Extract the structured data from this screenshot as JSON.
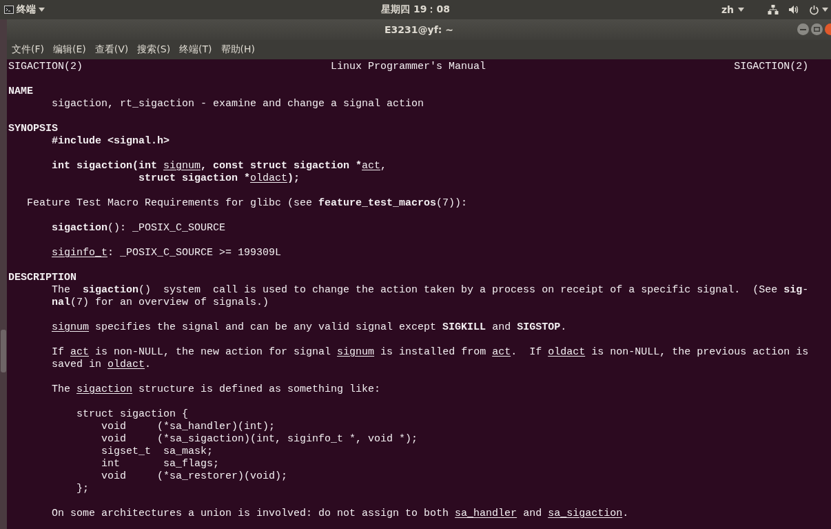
{
  "top_bar": {
    "app_menu": "终端",
    "clock": "星期四 19：08",
    "language": "zh"
  },
  "window": {
    "title": "E3231@yf: ~"
  },
  "menu_bar": [
    "文件(F)",
    "编辑(E)",
    "查看(V)",
    "搜索(S)",
    "终端(T)",
    "帮助(H)"
  ],
  "man_page": {
    "header": {
      "left": "SIGACTION(2)",
      "center": "Linux Programmer's Manual",
      "right": "SIGACTION(2)"
    },
    "lines": [
      {
        "kind": "blank"
      },
      {
        "kind": "heading",
        "segments": [
          {
            "text": "NAME",
            "kind": "bold"
          }
        ]
      },
      {
        "kind": "body",
        "segments": [
          {
            "text": "sigaction, rt_sigaction - examine and change a signal action",
            "kind": "plain"
          }
        ]
      },
      {
        "kind": "blank"
      },
      {
        "kind": "heading",
        "segments": [
          {
            "text": "SYNOPSIS",
            "kind": "bold"
          }
        ]
      },
      {
        "kind": "body",
        "segments": [
          {
            "text": "#include <signal.h>",
            "kind": "bold"
          }
        ]
      },
      {
        "kind": "blank"
      },
      {
        "kind": "body",
        "segments": [
          {
            "text": "int sigaction(int ",
            "kind": "bold"
          },
          {
            "text": "signum",
            "kind": "underline"
          },
          {
            "text": ", const struct sigaction *",
            "kind": "bold"
          },
          {
            "text": "act",
            "kind": "underline"
          },
          {
            "text": ",",
            "kind": "plain"
          }
        ]
      },
      {
        "kind": "continuation",
        "segments": [
          {
            "text": "struct sigaction *",
            "kind": "bold"
          },
          {
            "text": "oldact",
            "kind": "underline"
          },
          {
            "text": ");",
            "kind": "bold"
          }
        ]
      },
      {
        "kind": "blank"
      },
      {
        "kind": "subheading",
        "segments": [
          {
            "text": "Feature Test Macro Requirements for glibc (see ",
            "kind": "plain"
          },
          {
            "text": "feature_test_macros",
            "kind": "bold"
          },
          {
            "text": "(7)):",
            "kind": "plain"
          }
        ]
      },
      {
        "kind": "blank"
      },
      {
        "kind": "body",
        "segments": [
          {
            "text": "sigaction",
            "kind": "bold"
          },
          {
            "text": "(): _POSIX_C_SOURCE",
            "kind": "plain"
          }
        ]
      },
      {
        "kind": "blank"
      },
      {
        "kind": "body",
        "segments": [
          {
            "text": "siginfo_t",
            "kind": "underline"
          },
          {
            "text": ": _POSIX_C_SOURCE >= 199309L",
            "kind": "plain"
          }
        ]
      },
      {
        "kind": "blank"
      },
      {
        "kind": "heading",
        "segments": [
          {
            "text": "DESCRIPTION",
            "kind": "bold"
          }
        ]
      },
      {
        "kind": "body",
        "segments": [
          {
            "text": "The  ",
            "kind": "plain"
          },
          {
            "text": "sigaction",
            "kind": "bold"
          },
          {
            "text": "()  system  call is used to change the action taken by a process on receipt of a specific signal.  (See ",
            "kind": "plain"
          },
          {
            "text": "sig",
            "kind": "bold"
          },
          {
            "text": "‐",
            "kind": "plain"
          }
        ]
      },
      {
        "kind": "body",
        "segments": [
          {
            "text": "nal",
            "kind": "bold"
          },
          {
            "text": "(7) for an overview of signals.)",
            "kind": "plain"
          }
        ]
      },
      {
        "kind": "blank"
      },
      {
        "kind": "body",
        "segments": [
          {
            "text": "signum",
            "kind": "underline"
          },
          {
            "text": " specifies the signal and can be any valid signal except ",
            "kind": "plain"
          },
          {
            "text": "SIGKILL",
            "kind": "bold"
          },
          {
            "text": " and ",
            "kind": "plain"
          },
          {
            "text": "SIGSTOP",
            "kind": "bold"
          },
          {
            "text": ".",
            "kind": "plain"
          }
        ]
      },
      {
        "kind": "blank"
      },
      {
        "kind": "body",
        "segments": [
          {
            "text": "If ",
            "kind": "plain"
          },
          {
            "text": "act",
            "kind": "underline"
          },
          {
            "text": " is non-NULL, the new action for signal ",
            "kind": "plain"
          },
          {
            "text": "signum",
            "kind": "underline"
          },
          {
            "text": " is installed from ",
            "kind": "plain"
          },
          {
            "text": "act",
            "kind": "underline"
          },
          {
            "text": ".  If ",
            "kind": "plain"
          },
          {
            "text": "oldact",
            "kind": "underline"
          },
          {
            "text": " is non-NULL, the previous action is",
            "kind": "plain"
          }
        ]
      },
      {
        "kind": "body",
        "segments": [
          {
            "text": "saved in ",
            "kind": "plain"
          },
          {
            "text": "oldact",
            "kind": "underline"
          },
          {
            "text": ".",
            "kind": "plain"
          }
        ]
      },
      {
        "kind": "blank"
      },
      {
        "kind": "body",
        "segments": [
          {
            "text": "The ",
            "kind": "plain"
          },
          {
            "text": "sigaction",
            "kind": "underline"
          },
          {
            "text": " structure is defined as something like:",
            "kind": "plain"
          }
        ]
      },
      {
        "kind": "blank"
      },
      {
        "kind": "code",
        "segments": [
          {
            "text": "struct sigaction {",
            "kind": "plain"
          }
        ]
      },
      {
        "kind": "code-member",
        "segments": [
          {
            "text": "void     (*sa_handler)(int);",
            "kind": "plain"
          }
        ]
      },
      {
        "kind": "code-member",
        "segments": [
          {
            "text": "void     (*sa_sigaction)(int, siginfo_t *, void *);",
            "kind": "plain"
          }
        ]
      },
      {
        "kind": "code-member",
        "segments": [
          {
            "text": "sigset_t  sa_mask;",
            "kind": "plain"
          }
        ]
      },
      {
        "kind": "code-member",
        "segments": [
          {
            "text": "int       sa_flags;",
            "kind": "plain"
          }
        ]
      },
      {
        "kind": "code-member",
        "segments": [
          {
            "text": "void     (*sa_restorer)(void);",
            "kind": "plain"
          }
        ]
      },
      {
        "kind": "code",
        "segments": [
          {
            "text": "};",
            "kind": "plain"
          }
        ]
      },
      {
        "kind": "blank"
      },
      {
        "kind": "body",
        "segments": [
          {
            "text": "On some architectures a union is involved: do not assign to both ",
            "kind": "plain"
          },
          {
            "text": "sa_handler",
            "kind": "underline"
          },
          {
            "text": " and ",
            "kind": "plain"
          },
          {
            "text": "sa_sigaction",
            "kind": "underline"
          },
          {
            "text": ".",
            "kind": "plain"
          }
        ]
      }
    ]
  }
}
